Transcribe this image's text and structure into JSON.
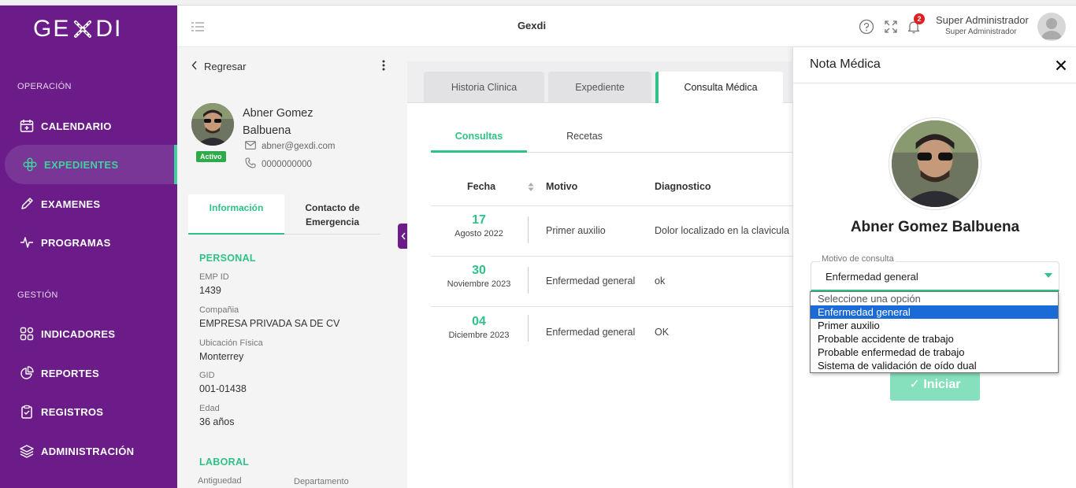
{
  "brand": {
    "logo_pre": "GE",
    "logo_post": "DI"
  },
  "sidebar": {
    "section_operacion": "OPERACIÓN",
    "section_gestion": "GESTIÓN",
    "items": [
      {
        "label": "CALENDARIO",
        "icon": "calendar-icon"
      },
      {
        "label": "EXPEDIENTES",
        "icon": "flower-icon",
        "active": true
      },
      {
        "label": "EXAMENES",
        "icon": "pen-icon"
      },
      {
        "label": "PROGRAMAS",
        "icon": "pulse-icon"
      },
      {
        "label": "INDICADORES",
        "icon": "grid-icon"
      },
      {
        "label": "REPORTES",
        "icon": "pie-chart-icon"
      },
      {
        "label": "REGISTROS",
        "icon": "clipboard-icon"
      },
      {
        "label": "ADMINISTRACIÓN",
        "icon": "layers-icon"
      }
    ]
  },
  "header": {
    "title": "Gexdi",
    "notif_count": "2",
    "user_name": "Super Administrador",
    "user_role": "Super Administrador"
  },
  "patient": {
    "back_label": "Regresar",
    "name": "Abner Gomez Balbuena",
    "status": "Activo",
    "email": "abner@gexdi.com",
    "phone": "0000000000",
    "tabs": [
      "Información",
      "Contacto de Emergencia"
    ],
    "personal_title": "PERSONAL",
    "fields": [
      {
        "label": "EMP ID",
        "value": "1439"
      },
      {
        "label": "Compañia",
        "value": "EMPRESA PRIVADA SA DE CV"
      },
      {
        "label": "Ubicación Física",
        "value": "Monterrey"
      },
      {
        "label": "GID",
        "value": "001-01438"
      },
      {
        "label": "Edad",
        "value": "36 años"
      }
    ],
    "laboral_title": "LABORAL",
    "laboral_labels": [
      "Antiguedad",
      "Departamento"
    ]
  },
  "main": {
    "tabs": [
      "Historia Clinica",
      "Expediente",
      "Consulta Médica"
    ],
    "active_tab": "Consulta Médica",
    "subtabs": [
      "Consultas",
      "Recetas"
    ],
    "columns": [
      "Fecha",
      "Motivo",
      "Diagnostico"
    ],
    "rows": [
      {
        "day": "17",
        "month_year": "Agosto 2022",
        "motivo": "Primer auxilio",
        "diagnostico": "Dolor localizado en la clavicula"
      },
      {
        "day": "30",
        "month_year": "Noviembre 2023",
        "motivo": "Enfermedad general",
        "diagnostico": "ok"
      },
      {
        "day": "04",
        "month_year": "Diciembre 2023",
        "motivo": "Enfermedad general",
        "diagnostico": "OK"
      }
    ]
  },
  "nota": {
    "title": "Nota Médica",
    "patient_name": "Abner Gomez Balbuena",
    "select_label": "Motivo de consulta",
    "select_value": "Enfermedad general",
    "options": [
      "Seleccione una opción",
      "Enfermedad general",
      "Primer auxilio",
      "Probable accidente de trabajo",
      "Probable enfermedad de trabajo",
      "Sistema de validación de oído dual"
    ],
    "selected_option": "Enfermedad general",
    "start_label": "Iniciar"
  },
  "colors": {
    "sidebar": "#6b1c88",
    "accent": "#2fc287",
    "badge": "#e02020"
  }
}
